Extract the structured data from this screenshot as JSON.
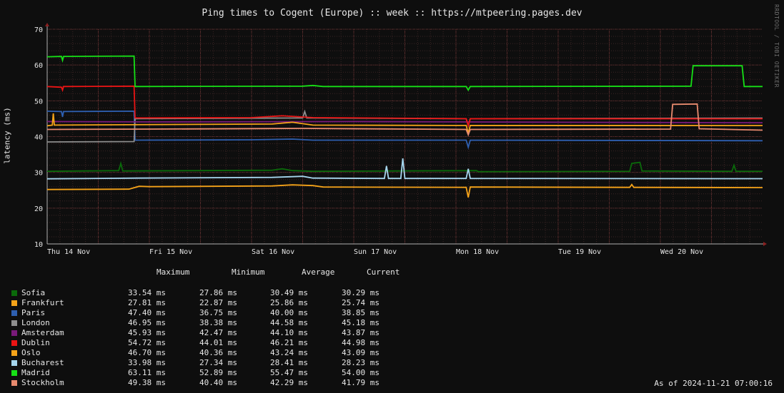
{
  "chart_data": {
    "type": "line",
    "title": "Ping times to Cogent (Europe) :: week :: https://mtpeering.pages.dev",
    "ylabel": "latency (ms)",
    "ylim": [
      10,
      70
    ],
    "yticks": [
      "10",
      "20",
      "30",
      "40",
      "50",
      "60",
      "70"
    ],
    "xticks": [
      "Thu 14 Nov",
      "Fri 15 Nov",
      "Sat 16 Nov",
      "Sun 17 Nov",
      "Mon 18 Nov",
      "Tue 19 Nov",
      "Wed 20 Nov"
    ],
    "xlim_days": [
      0,
      7.0
    ],
    "grid": true,
    "side_label": "RRDTOOL / TOBI OETIKER",
    "as_of": "As of 2024-11-21 07:00:16",
    "legend_headers": [
      "Maximum",
      "Minimum",
      "Average",
      "Current"
    ],
    "series": [
      {
        "name": "Sofia",
        "color": "#0a6a0a",
        "max": "33.54 ms",
        "min": "27.86 ms",
        "avg": "30.49 ms",
        "cur": "30.29 ms",
        "points": [
          [
            0,
            30.3
          ],
          [
            0.7,
            30.5
          ],
          [
            0.72,
            32.5
          ],
          [
            0.74,
            30.4
          ],
          [
            2.2,
            30.6
          ],
          [
            2.3,
            31
          ],
          [
            2.4,
            30.5
          ],
          [
            2.6,
            30.3
          ],
          [
            4.2,
            30.5
          ],
          [
            4.22,
            30.2
          ],
          [
            5.7,
            30.3
          ],
          [
            5.72,
            32.5
          ],
          [
            5.8,
            32.8
          ],
          [
            5.82,
            30.4
          ],
          [
            6.7,
            30.3
          ],
          [
            6.72,
            32
          ],
          [
            6.74,
            30.3
          ],
          [
            7.0,
            30.29
          ]
        ]
      },
      {
        "name": "Frankfurt",
        "color": "#f5a319",
        "max": "27.81 ms",
        "min": "22.87 ms",
        "avg": "25.86 ms",
        "cur": "25.74 ms",
        "points": [
          [
            0,
            25.2
          ],
          [
            0.8,
            25.3
          ],
          [
            0.9,
            26.1
          ],
          [
            1,
            26
          ],
          [
            2.2,
            26.2
          ],
          [
            2.4,
            26.5
          ],
          [
            2.6,
            26.3
          ],
          [
            2.7,
            25.9
          ],
          [
            4.1,
            25.8
          ],
          [
            4.12,
            23
          ],
          [
            4.14,
            25.9
          ],
          [
            5.7,
            25.8
          ],
          [
            5.72,
            26.6
          ],
          [
            5.74,
            25.8
          ],
          [
            7.0,
            25.74
          ]
        ]
      },
      {
        "name": "Paris",
        "color": "#2e5fb0",
        "max": "47.40 ms",
        "min": "36.75 ms",
        "avg": "40.00 ms",
        "cur": "38.85 ms",
        "points": [
          [
            0,
            47.1
          ],
          [
            0.14,
            47
          ],
          [
            0.15,
            45.5
          ],
          [
            0.16,
            47
          ],
          [
            0.85,
            47.1
          ],
          [
            0.86,
            39
          ],
          [
            2.0,
            39.1
          ],
          [
            2.4,
            39.3
          ],
          [
            2.6,
            39
          ],
          [
            4.1,
            39
          ],
          [
            4.12,
            37
          ],
          [
            4.14,
            39
          ],
          [
            7.0,
            38.85
          ]
        ]
      },
      {
        "name": "London",
        "color": "#8e8e8e",
        "max": "46.95 ms",
        "min": "38.38 ms",
        "avg": "44.58 ms",
        "cur": "45.18 ms",
        "points": [
          [
            0,
            38.5
          ],
          [
            0.85,
            38.6
          ],
          [
            0.86,
            45
          ],
          [
            2.5,
            45.2
          ],
          [
            2.52,
            47
          ],
          [
            2.54,
            45.2
          ],
          [
            4.1,
            45
          ],
          [
            4.12,
            43
          ],
          [
            4.14,
            45
          ],
          [
            7.0,
            45.18
          ]
        ]
      },
      {
        "name": "Amsterdam",
        "color": "#7a1a7a",
        "max": "45.93 ms",
        "min": "42.47 ms",
        "avg": "44.10 ms",
        "cur": "43.87 ms",
        "points": [
          [
            0,
            44.2
          ],
          [
            1,
            44.1
          ],
          [
            3,
            44.2
          ],
          [
            5,
            44
          ],
          [
            7.0,
            43.87
          ]
        ]
      },
      {
        "name": "Dublin",
        "color": "#ea1414",
        "max": "54.72 ms",
        "min": "44.01 ms",
        "avg": "46.21 ms",
        "cur": "44.98 ms",
        "points": [
          [
            0,
            54
          ],
          [
            0.14,
            53.8
          ],
          [
            0.15,
            53
          ],
          [
            0.16,
            54
          ],
          [
            0.85,
            54.1
          ],
          [
            0.86,
            45.2
          ],
          [
            2.0,
            45.3
          ],
          [
            2.3,
            45.8
          ],
          [
            2.6,
            45.3
          ],
          [
            4.1,
            45
          ],
          [
            4.12,
            43
          ],
          [
            4.14,
            45
          ],
          [
            7.0,
            44.98
          ]
        ]
      },
      {
        "name": "Oslo",
        "color": "#f5a319",
        "max": "46.70 ms",
        "min": "40.36 ms",
        "avg": "43.24 ms",
        "cur": "43.09 ms",
        "points": [
          [
            0,
            43
          ],
          [
            0.05,
            43.2
          ],
          [
            0.06,
            46.5
          ],
          [
            0.07,
            43.2
          ],
          [
            2.2,
            43.5
          ],
          [
            2.4,
            44
          ],
          [
            2.6,
            43.2
          ],
          [
            4.1,
            43.1
          ],
          [
            4.12,
            41
          ],
          [
            4.14,
            43.1
          ],
          [
            7.0,
            43.09
          ]
        ]
      },
      {
        "name": "Bucharest",
        "color": "#a6d6ee",
        "max": "33.98 ms",
        "min": "27.34 ms",
        "avg": "28.41 ms",
        "cur": "28.23 ms",
        "points": [
          [
            0,
            28.2
          ],
          [
            0.9,
            28.4
          ],
          [
            2.2,
            28.6
          ],
          [
            2.5,
            28.9
          ],
          [
            2.6,
            28.4
          ],
          [
            3.3,
            28.3
          ],
          [
            3.32,
            31.8
          ],
          [
            3.34,
            28.3
          ],
          [
            3.46,
            28.3
          ],
          [
            3.48,
            33.9
          ],
          [
            3.5,
            28.3
          ],
          [
            4.1,
            28.3
          ],
          [
            4.12,
            31
          ],
          [
            4.14,
            28.3
          ],
          [
            7.0,
            28.23
          ]
        ]
      },
      {
        "name": "Madrid",
        "color": "#16e016",
        "max": "63.11 ms",
        "min": "52.89 ms",
        "avg": "55.47 ms",
        "cur": "54.00 ms",
        "points": [
          [
            0,
            62.3
          ],
          [
            0.14,
            62.4
          ],
          [
            0.15,
            61.3
          ],
          [
            0.16,
            62.4
          ],
          [
            0.85,
            62.5
          ],
          [
            0.86,
            54
          ],
          [
            2.5,
            54.1
          ],
          [
            2.6,
            54.3
          ],
          [
            2.7,
            54
          ],
          [
            4.1,
            54
          ],
          [
            4.12,
            53
          ],
          [
            4.14,
            54
          ],
          [
            6.3,
            54.1
          ],
          [
            6.32,
            59.8
          ],
          [
            6.8,
            59.8
          ],
          [
            6.82,
            54
          ],
          [
            7.0,
            54.0
          ]
        ]
      },
      {
        "name": "Stockholm",
        "color": "#e88a6e",
        "max": "49.38 ms",
        "min": "40.40 ms",
        "avg": "42.29 ms",
        "cur": "41.79 ms",
        "points": [
          [
            0,
            42
          ],
          [
            1,
            42.1
          ],
          [
            2.5,
            42.3
          ],
          [
            4.1,
            42
          ],
          [
            4.12,
            40.5
          ],
          [
            4.14,
            42
          ],
          [
            6.1,
            42.1
          ],
          [
            6.12,
            49
          ],
          [
            6.36,
            49.1
          ],
          [
            6.38,
            42.2
          ],
          [
            7.0,
            41.79
          ]
        ]
      }
    ]
  }
}
